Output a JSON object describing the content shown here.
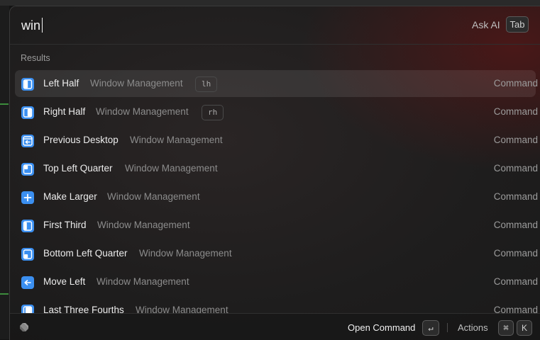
{
  "search": {
    "value": "win"
  },
  "ask_ai": {
    "label": "Ask AI",
    "key": "Tab"
  },
  "section": {
    "label": "Results"
  },
  "results": [
    {
      "title": "Left Half",
      "subtitle": "Window Management",
      "alias": "lh",
      "kind": "Command",
      "icon": "left-half-icon",
      "selected": true
    },
    {
      "title": "Right Half",
      "subtitle": "Window Management",
      "alias": "rh",
      "kind": "Command",
      "icon": "right-half-icon"
    },
    {
      "title": "Previous Desktop",
      "subtitle": "Window Management",
      "kind": "Command",
      "icon": "previous-desktop-icon"
    },
    {
      "title": "Top Left Quarter",
      "subtitle": "Window Management",
      "kind": "Command",
      "icon": "top-left-quarter-icon"
    },
    {
      "title": "Make Larger",
      "subtitle": "Window Management",
      "kind": "Command",
      "icon": "plus-icon"
    },
    {
      "title": "First Third",
      "subtitle": "Window Management",
      "kind": "Command",
      "icon": "first-third-icon"
    },
    {
      "title": "Bottom Left Quarter",
      "subtitle": "Window Management",
      "kind": "Command",
      "icon": "bottom-left-quarter-icon"
    },
    {
      "title": "Move Left",
      "subtitle": "Window Management",
      "kind": "Command",
      "icon": "move-left-icon"
    },
    {
      "title": "Last Three Fourths",
      "subtitle": "Window Management",
      "kind": "Command",
      "icon": "last-three-fourths-icon"
    }
  ],
  "footer": {
    "primary_action": "Open Command",
    "primary_key": "↵",
    "actions_label": "Actions",
    "actions_keys": [
      "⌘",
      "K"
    ]
  },
  "colors": {
    "accent": "#3b8ff0",
    "selected_row": "#2f2c2c",
    "background": "#1e1d1d"
  }
}
